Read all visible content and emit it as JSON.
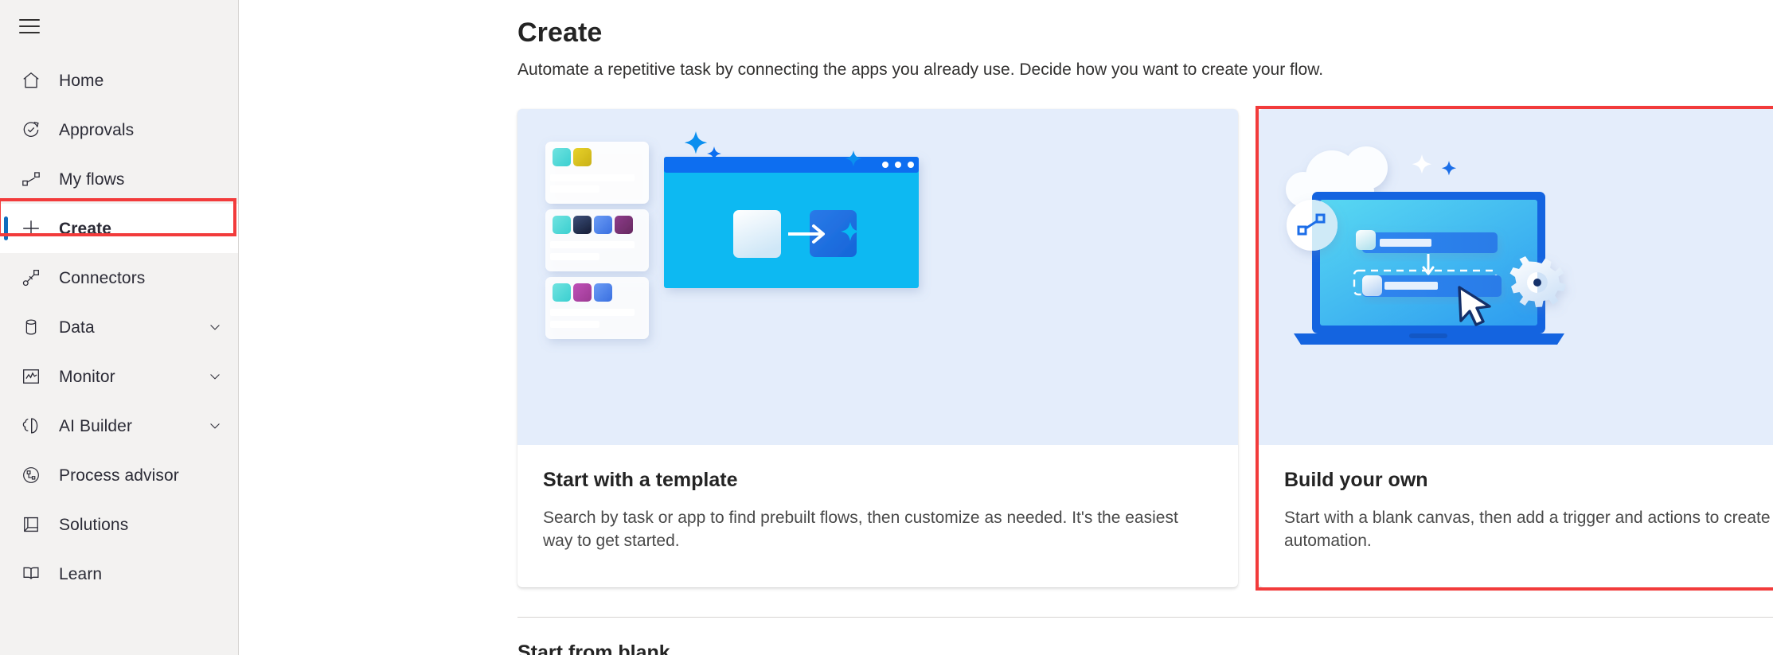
{
  "sidebar": {
    "menu_button": "hamburger-menu",
    "items": [
      {
        "label": "Home",
        "icon": "home-icon",
        "expandable": false,
        "selected": false
      },
      {
        "label": "Approvals",
        "icon": "approvals-icon",
        "expandable": false,
        "selected": false
      },
      {
        "label": "My flows",
        "icon": "my-flows-icon",
        "expandable": false,
        "selected": false
      },
      {
        "label": "Create",
        "icon": "plus-icon",
        "expandable": false,
        "selected": true
      },
      {
        "label": "Connectors",
        "icon": "connectors-icon",
        "expandable": false,
        "selected": false
      },
      {
        "label": "Data",
        "icon": "database-icon",
        "expandable": true,
        "selected": false
      },
      {
        "label": "Monitor",
        "icon": "monitor-chart-icon",
        "expandable": true,
        "selected": false
      },
      {
        "label": "AI Builder",
        "icon": "ai-builder-brain-icon",
        "expandable": true,
        "selected": false
      },
      {
        "label": "Process advisor",
        "icon": "process-advisor-icon",
        "expandable": false,
        "selected": false
      },
      {
        "label": "Solutions",
        "icon": "solutions-icon",
        "expandable": false,
        "selected": false
      },
      {
        "label": "Learn",
        "icon": "learn-book-icon",
        "expandable": false,
        "selected": false
      }
    ]
  },
  "header": {
    "title": "Create",
    "subtitle": "Automate a repetitive task by connecting the apps you already use. Decide how you want to create your flow."
  },
  "cards": [
    {
      "title": "Start with a template",
      "description": "Search by task or app to find prebuilt flows, then customize as needed. It's the easiest way to get started.",
      "illustration": "template-gallery-illustration",
      "highlighted": false
    },
    {
      "title": "Build your own",
      "description": "Start with a blank canvas, then add a trigger and actions to create your own custom automation.",
      "illustration": "laptop-blank-canvas-illustration",
      "highlighted": true
    }
  ],
  "bottom_section_peek": "Start from blank",
  "colors": {
    "sidebar_bg": "#f3f2f1",
    "selected_indicator": "#0f6cbd",
    "highlight_red": "#f23b3b",
    "card_art_bg": "#e4edfb",
    "accent_blue": "#0f6cbd",
    "text_primary": "#242424",
    "text_secondary": "#4a4a4a"
  }
}
